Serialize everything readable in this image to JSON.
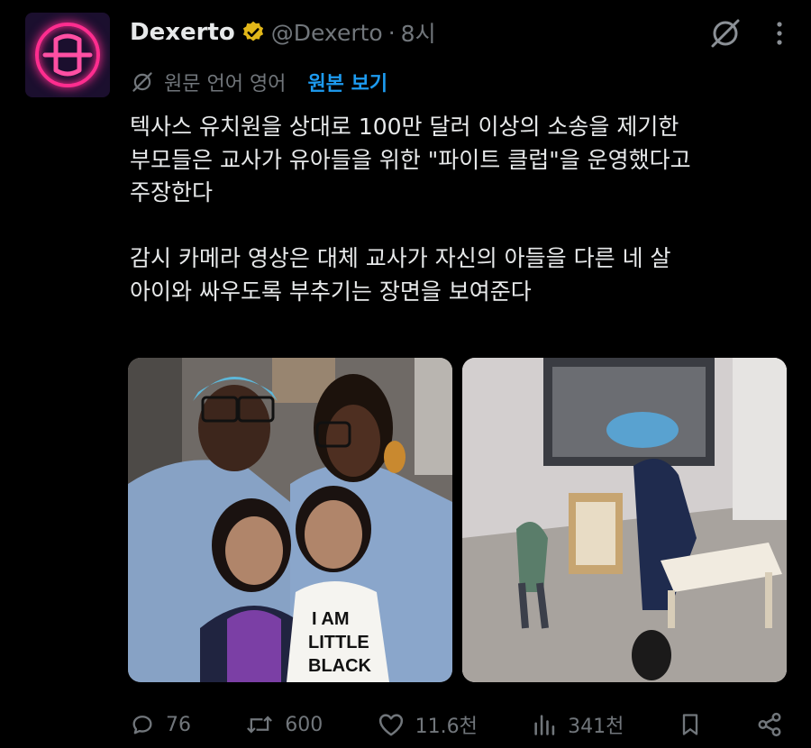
{
  "tweet": {
    "author_name": "Dexerto",
    "handle": "@Dexerto",
    "separator": "·",
    "time": "8시",
    "translate_meta": "원문 언어 영어",
    "translate_link": "원본 보기",
    "text": "텍사스 유치원을 상대로 100만 달러 이상의 소송을 제기한\n부모들은 교사가 유아들을 위한 \"파이트 클럽\"을 운영했다고\n주장한다\n\n감시 카메라 영상은 대체 교사가 자신의 아들을 다른 네 살\n아이와 싸우도록 부추기는 장면을 보여준다",
    "shirt_text": [
      "I AM",
      "LITTLE",
      "BLACK"
    ]
  },
  "actions": {
    "replies": "76",
    "reposts": "600",
    "likes": "11.6천",
    "views": "341천"
  },
  "icons": {
    "verified": "verified-badge-icon",
    "grok": "grok-icon",
    "more": "more-vertical-icon",
    "reply": "reply-icon",
    "repost": "repost-icon",
    "like": "heart-icon",
    "views": "views-bar-icon",
    "bookmark": "bookmark-icon",
    "share": "share-icon"
  },
  "colors": {
    "background": "#000000",
    "text": "#e7e9ea",
    "muted": "#71767b",
    "link": "#1d9bf0",
    "verified": "#e2b719",
    "brand": "#ff2d8f"
  }
}
